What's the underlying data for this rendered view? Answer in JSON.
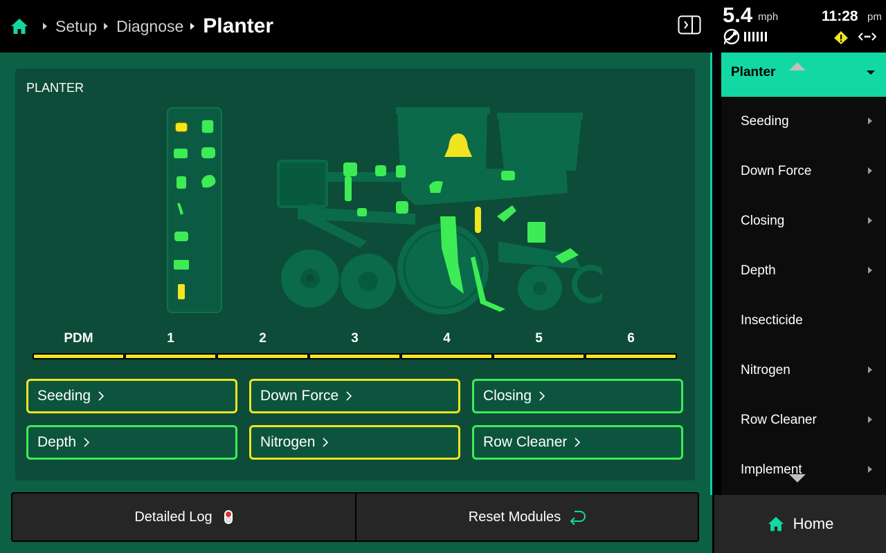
{
  "breadcrumb": {
    "items": [
      "Setup",
      "Diagnose"
    ],
    "current": "Planter"
  },
  "status": {
    "speed": "5.4",
    "speed_unit": "mph",
    "time": "11:28",
    "ampm": "pm"
  },
  "card": {
    "title": "PLANTER"
  },
  "rows": [
    "PDM",
    "1",
    "2",
    "3",
    "4",
    "5",
    "6"
  ],
  "tiles": [
    {
      "label": "Seeding",
      "state": "warning"
    },
    {
      "label": "Down Force",
      "state": "warning"
    },
    {
      "label": "Closing",
      "state": "ok"
    },
    {
      "label": "Depth",
      "state": "ok"
    },
    {
      "label": "Nitrogen",
      "state": "warning"
    },
    {
      "label": "Row Cleaner",
      "state": "ok"
    }
  ],
  "footer": {
    "detailed_log": "Detailed Log",
    "reset_modules": "Reset Modules"
  },
  "sidebar": {
    "header": "Planter",
    "items": [
      "Seeding",
      "Down Force",
      "Closing",
      "Depth",
      "Insecticide",
      "Nitrogen",
      "Row Cleaner",
      "Implement"
    ]
  },
  "home_button": "Home",
  "colors": {
    "ok": "#3dec55",
    "warning": "#f1e420",
    "accent": "#12d9a3"
  }
}
